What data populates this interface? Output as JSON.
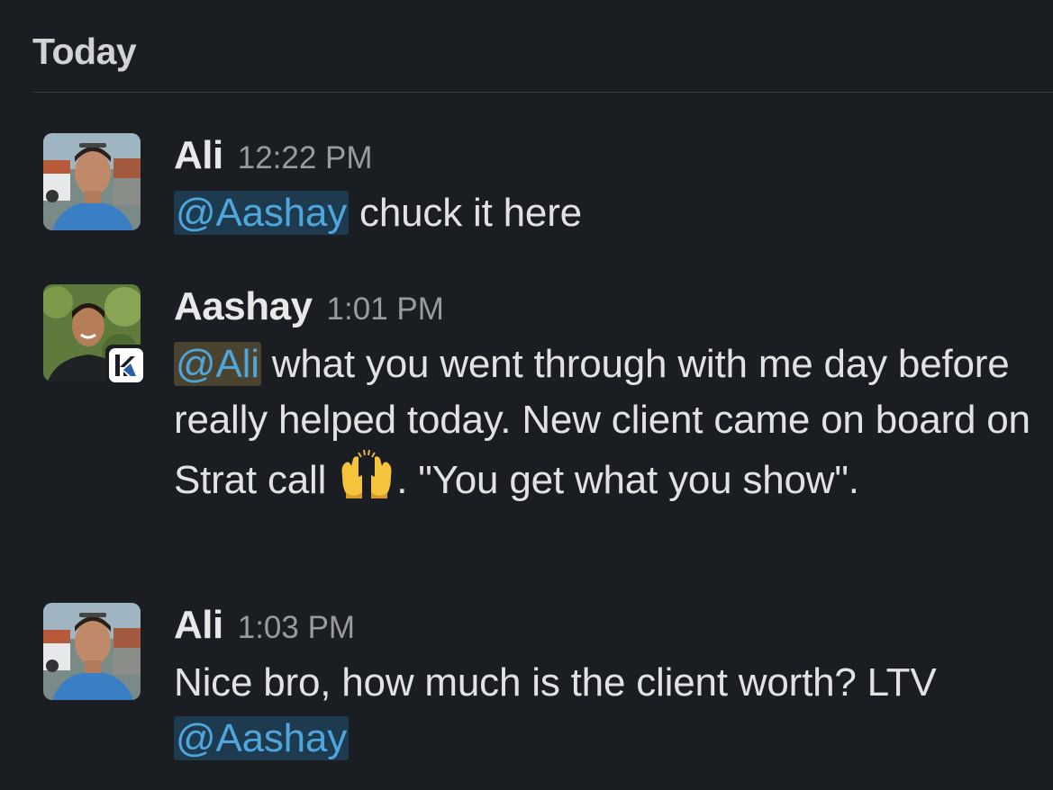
{
  "day_header": "Today",
  "messages": [
    {
      "author": "Ali",
      "time": "12:22 PM",
      "avatar": "ali-avatar",
      "parts": {
        "mention": "@Aashay",
        "text": " chuck it here"
      }
    },
    {
      "author": "Aashay",
      "time": "1:01 PM",
      "avatar": "aashay-avatar",
      "badge": "k-app-badge-icon",
      "parts": {
        "mention": "@Ali",
        "text1": " what you went through with me day before really helped today. New client came on board on Strat call ",
        "emoji": "raised-hands-icon",
        "text2": ". \"You get what you show\"."
      }
    },
    {
      "author": "Ali",
      "time": "1:03 PM",
      "avatar": "ali-avatar",
      "parts": {
        "text": "Nice bro, how much is the client worth? LTV ",
        "mention": "@Aashay"
      }
    }
  ],
  "colors": {
    "background": "#1a1d21",
    "mention": "#4ea6dd",
    "mention_bg": "#1d3a4e",
    "self_mention_bg": "#4a4330"
  }
}
